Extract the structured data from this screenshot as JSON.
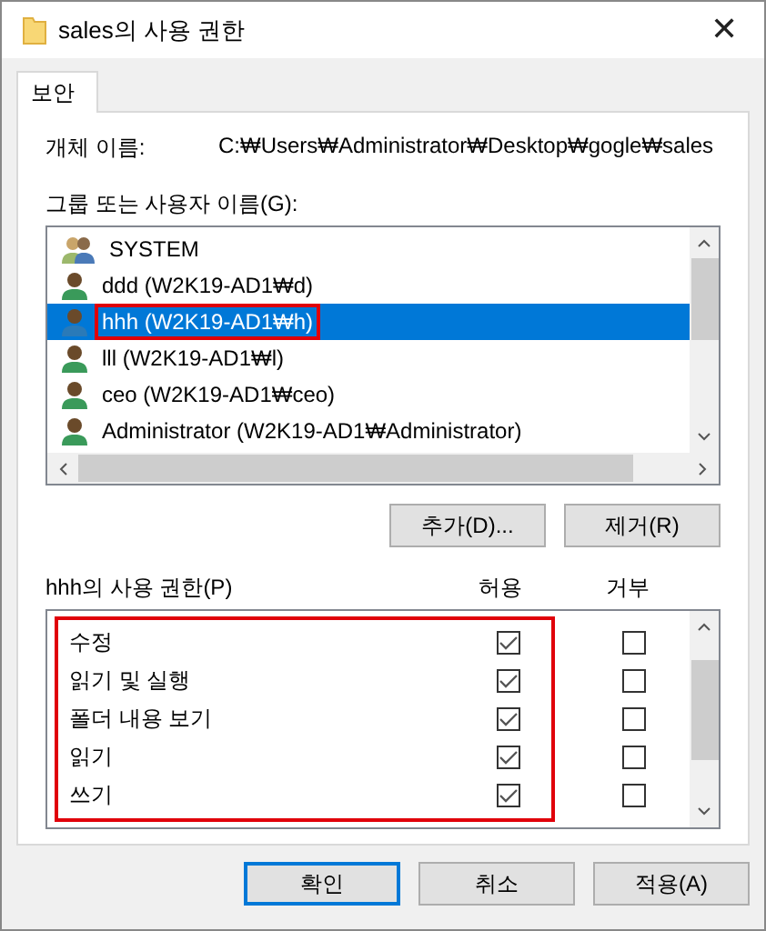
{
  "window": {
    "title": "sales의 사용 권한",
    "close": "✕"
  },
  "tabs": [
    {
      "label": "보안",
      "selected": true
    }
  ],
  "object_name": {
    "label": "개체 이름:",
    "value": "C:₩Users₩Administrator₩Desktop₩gogle₩sales"
  },
  "users": {
    "label": "그룹 또는 사용자 이름(G):",
    "items": [
      {
        "name": "SYSTEM",
        "kind": "group",
        "selected": false,
        "highlighted": false
      },
      {
        "name": "ddd (W2K19-AD1₩d)",
        "kind": "user",
        "selected": false,
        "highlighted": false
      },
      {
        "name": "hhh (W2K19-AD1₩h)",
        "kind": "user",
        "selected": true,
        "highlighted": true
      },
      {
        "name": "lll (W2K19-AD1₩l)",
        "kind": "user",
        "selected": false,
        "highlighted": false
      },
      {
        "name": "ceo (W2K19-AD1₩ceo)",
        "kind": "user",
        "selected": false,
        "highlighted": false
      },
      {
        "name": "Administrator (W2K19-AD1₩Administrator)",
        "kind": "user",
        "selected": false,
        "highlighted": false
      }
    ],
    "buttons": [
      "추가(D)...",
      "제거(R)"
    ]
  },
  "permissions": {
    "label": "hhh의 사용 권한(P)",
    "allow_header": "허용",
    "deny_header": "거부",
    "highlighted": true,
    "items": [
      {
        "name": "수정",
        "allow": true,
        "deny": false
      },
      {
        "name": "읽기 및 실행",
        "allow": true,
        "deny": false
      },
      {
        "name": "폴더 내용 보기",
        "allow": true,
        "deny": false
      },
      {
        "name": "읽기",
        "allow": true,
        "deny": false
      },
      {
        "name": "쓰기",
        "allow": true,
        "deny": false
      }
    ]
  },
  "buttons": [
    {
      "label": "확인",
      "default": true
    },
    {
      "label": "취소",
      "default": false
    },
    {
      "label": "적용(A)",
      "default": false
    }
  ]
}
